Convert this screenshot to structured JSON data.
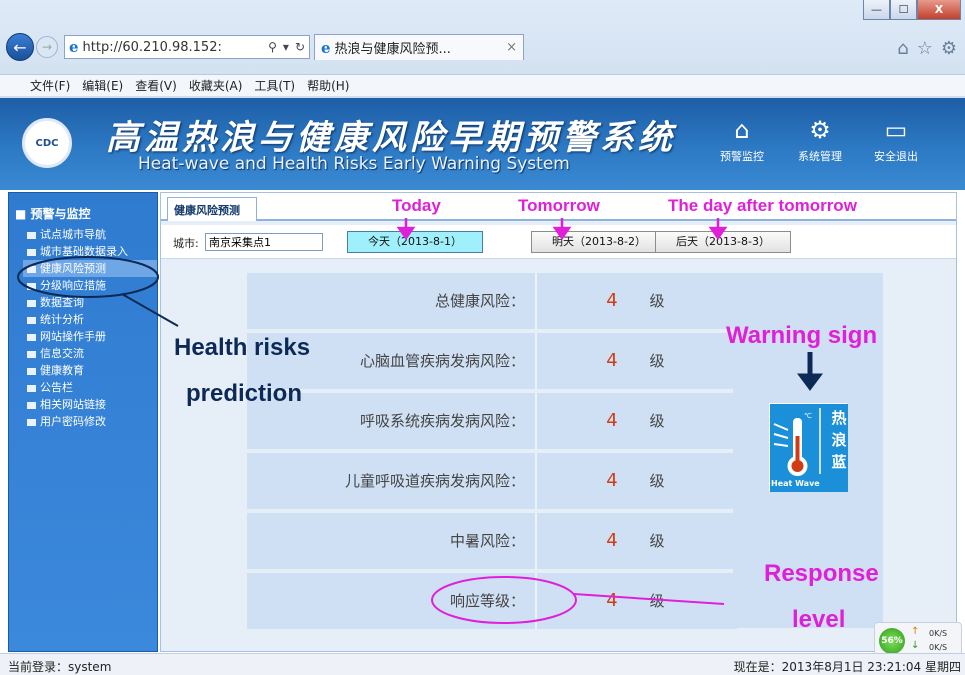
{
  "browser": {
    "url": "http://60.210.98.152:",
    "tab_title": "热浪与健康风险预...",
    "tab_close": "×",
    "menu": [
      "文件(F)",
      "编辑(E)",
      "查看(V)",
      "收藏夹(A)",
      "工具(T)",
      "帮助(H)"
    ],
    "window_controls": [
      "—",
      "☐",
      "X"
    ]
  },
  "app": {
    "title_cn": "高温热浪与健康风险早期预警系统",
    "title_en": "Heat-wave and Health Risks Early Warning System",
    "logo_text": "CDC",
    "header_buttons": [
      {
        "label": "预警监控",
        "icon": "home-icon"
      },
      {
        "label": "系统管理",
        "icon": "settings-icon"
      },
      {
        "label": "安全退出",
        "icon": "exit-door-icon"
      }
    ]
  },
  "sidebar": {
    "section_title": "预警与监控",
    "items": [
      {
        "label": "试点城市导航",
        "active": false
      },
      {
        "label": "城市基础数据录入",
        "active": false
      },
      {
        "label": "健康风险预测",
        "active": true
      },
      {
        "label": "分级响应措施",
        "active": false
      },
      {
        "label": "数据查询",
        "active": false
      },
      {
        "label": "统计分析",
        "active": false
      },
      {
        "label": "网站操作手册",
        "active": false
      },
      {
        "label": "信息交流",
        "active": false
      },
      {
        "label": "健康教育",
        "active": false
      },
      {
        "label": "公告栏",
        "active": false
      },
      {
        "label": "相关网站链接",
        "active": false
      },
      {
        "label": "用户密码修改",
        "active": false
      }
    ]
  },
  "main": {
    "tab_label": "健康风险预测",
    "city_label": "城市:",
    "city_value": "南京采集点1",
    "day_buttons": [
      "今天（2013-8-1）",
      "明天（2013-8-2）",
      "后天（2013-8-3）"
    ],
    "selected_day_index": 0,
    "risks": [
      {
        "label": "总健康风险：",
        "level": "4",
        "unit": "级"
      },
      {
        "label": "心脑血管疾病发病风险：",
        "level": "4",
        "unit": "级"
      },
      {
        "label": "呼吸系统疾病发病风险：",
        "level": "4",
        "unit": "级"
      },
      {
        "label": "儿童呼吸道疾病发病风险：",
        "level": "4",
        "unit": "级"
      },
      {
        "label": "中暑风险：",
        "level": "4",
        "unit": "级"
      },
      {
        "label": "响应等级：",
        "level": "4",
        "unit": "级"
      }
    ],
    "warning_sign": {
      "chars": [
        "热",
        "浪",
        "蓝"
      ],
      "caption": "Heat Wave",
      "color": "#1b8fd8"
    }
  },
  "annotations": {
    "today": "Today",
    "tomorrow": "Tomorrow",
    "day_after": "The day after tomorrow",
    "health_risks_line1": "Health risks",
    "health_risks_line2": "prediction",
    "warning_sign": "Warning sign",
    "response_line1": "Response",
    "response_line2": "level",
    "color_magenta": "#e020d8",
    "color_navy": "#0d2a56"
  },
  "status": {
    "login": "当前登录：system",
    "now": "现在是：2013年8月1日 23:21:04 星期四",
    "net_percent": "56%",
    "net_up": "0K/S",
    "net_down": "0K/S"
  }
}
